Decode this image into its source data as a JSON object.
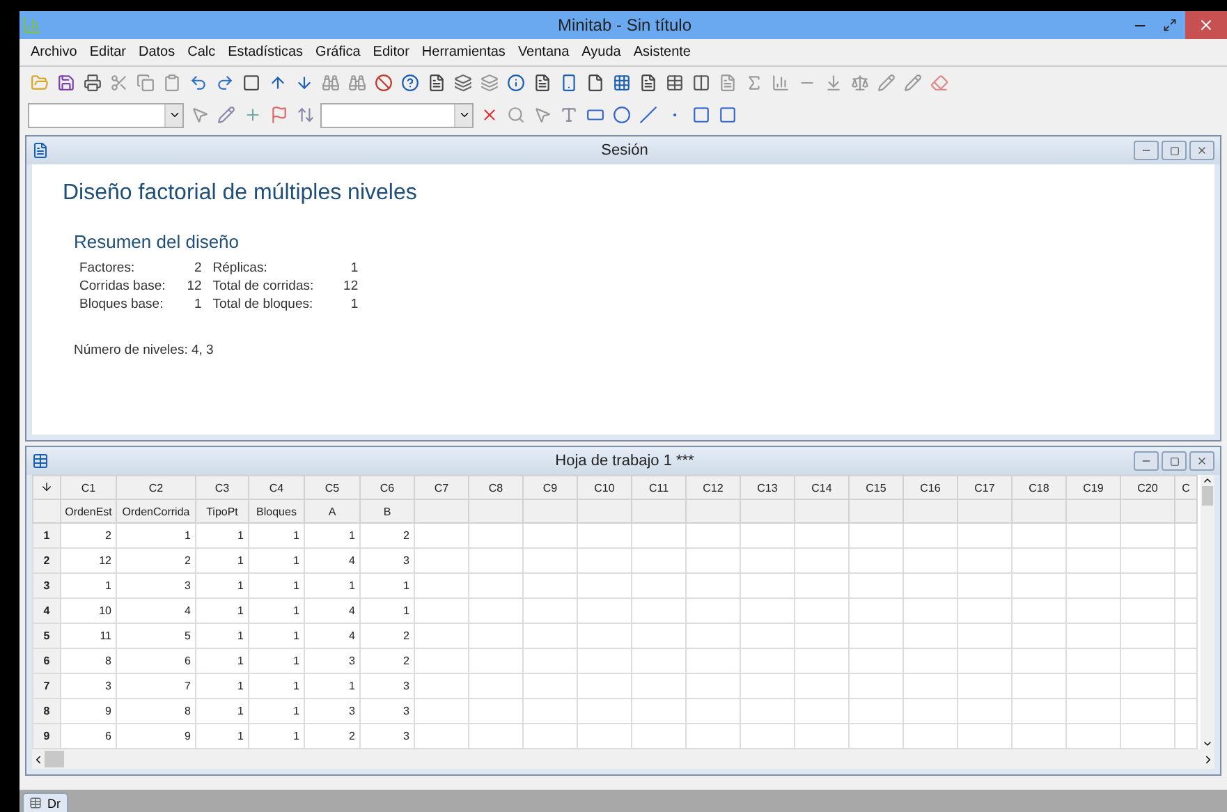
{
  "app": {
    "title": "Minitab - Sin título"
  },
  "menu": [
    "Archivo",
    "Editar",
    "Datos",
    "Calc",
    "Estadísticas",
    "Gráfica",
    "Editor",
    "Herramientas",
    "Ventana",
    "Ayuda",
    "Asistente"
  ],
  "session": {
    "title": "Sesión",
    "heading": "Diseño factorial de múltiples niveles",
    "subheading": "Resumen del diseño",
    "summary": [
      {
        "label": "Factores:",
        "value": "2",
        "label2": "Réplicas:",
        "value2": "1"
      },
      {
        "label": "Corridas base:",
        "value": "12",
        "label2": "Total de corridas:",
        "value2": "12"
      },
      {
        "label": "Bloques base:",
        "value": "1",
        "label2": "Total de bloques:",
        "value2": "1"
      }
    ],
    "levels": "Número de niveles: 4, 3"
  },
  "worksheet": {
    "title": "Hoja de trabajo 1 ***",
    "columns": [
      {
        "id": "C1",
        "name": "OrdenEst"
      },
      {
        "id": "C2",
        "name": "OrdenCorrida"
      },
      {
        "id": "C3",
        "name": "TipoPt"
      },
      {
        "id": "C4",
        "name": "Bloques"
      },
      {
        "id": "C5",
        "name": "A"
      },
      {
        "id": "C6",
        "name": "B"
      },
      {
        "id": "C7"
      },
      {
        "id": "C8"
      },
      {
        "id": "C9"
      },
      {
        "id": "C10"
      },
      {
        "id": "C11"
      },
      {
        "id": "C12"
      },
      {
        "id": "C13"
      },
      {
        "id": "C14"
      },
      {
        "id": "C15"
      },
      {
        "id": "C16"
      },
      {
        "id": "C17"
      },
      {
        "id": "C18"
      },
      {
        "id": "C19"
      },
      {
        "id": "C20"
      },
      {
        "id": "C"
      }
    ],
    "rows": [
      {
        "num": "1",
        "cells": [
          "2",
          "1",
          "1",
          "1",
          "1",
          "2"
        ]
      },
      {
        "num": "2",
        "cells": [
          "12",
          "2",
          "1",
          "1",
          "4",
          "3"
        ]
      },
      {
        "num": "3",
        "cells": [
          "1",
          "3",
          "1",
          "1",
          "1",
          "1"
        ]
      },
      {
        "num": "4",
        "cells": [
          "10",
          "4",
          "1",
          "1",
          "4",
          "1"
        ]
      },
      {
        "num": "5",
        "cells": [
          "11",
          "5",
          "1",
          "1",
          "4",
          "2"
        ]
      },
      {
        "num": "6",
        "cells": [
          "8",
          "6",
          "1",
          "1",
          "3",
          "2"
        ]
      },
      {
        "num": "7",
        "cells": [
          "3",
          "7",
          "1",
          "1",
          "1",
          "3"
        ]
      },
      {
        "num": "8",
        "cells": [
          "9",
          "8",
          "1",
          "1",
          "3",
          "3"
        ]
      },
      {
        "num": "9",
        "cells": [
          "6",
          "9",
          "1",
          "1",
          "2",
          "3"
        ]
      }
    ]
  },
  "taskbar": {
    "tab": "Dr"
  }
}
